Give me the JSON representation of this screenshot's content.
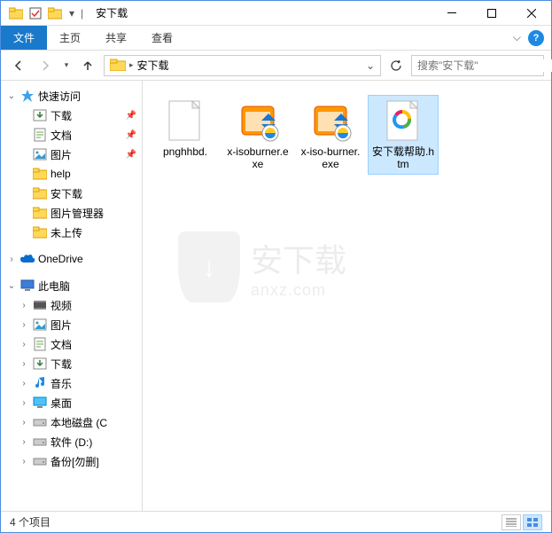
{
  "window": {
    "title": "安下载"
  },
  "ribbon": {
    "file": "文件",
    "home": "主页",
    "share": "共享",
    "view": "查看"
  },
  "address": {
    "path": "安下载"
  },
  "search": {
    "placeholder": "搜索\"安下载\""
  },
  "sidebar": {
    "quick_access": "快速访问",
    "items": [
      {
        "label": "下载",
        "pinned": true,
        "icon": "download"
      },
      {
        "label": "文档",
        "pinned": true,
        "icon": "document"
      },
      {
        "label": "图片",
        "pinned": true,
        "icon": "pictures"
      },
      {
        "label": "help",
        "pinned": false,
        "icon": "folder"
      },
      {
        "label": "安下载",
        "pinned": false,
        "icon": "folder"
      },
      {
        "label": "图片管理器",
        "pinned": false,
        "icon": "folder"
      },
      {
        "label": "未上传",
        "pinned": false,
        "icon": "folder"
      }
    ],
    "onedrive": "OneDrive",
    "this_pc": "此电脑",
    "pc_items": [
      {
        "label": "视频",
        "icon": "video"
      },
      {
        "label": "图片",
        "icon": "pictures"
      },
      {
        "label": "文档",
        "icon": "document"
      },
      {
        "label": "下载",
        "icon": "download"
      },
      {
        "label": "音乐",
        "icon": "music"
      },
      {
        "label": "桌面",
        "icon": "desktop"
      },
      {
        "label": "本地磁盘 (C",
        "icon": "drive"
      },
      {
        "label": "软件 (D:)",
        "icon": "drive"
      },
      {
        "label": "备份[勿删]",
        "icon": "drive"
      }
    ]
  },
  "files": [
    {
      "name": "pnghhbd.",
      "type": "blank"
    },
    {
      "name": "x-isoburner.exe",
      "type": "exe"
    },
    {
      "name": "x-iso-burner.exe",
      "type": "exe"
    },
    {
      "name": "安下载帮助.htm",
      "type": "htm"
    }
  ],
  "status": {
    "count": "4 个项目"
  },
  "watermark": {
    "cn": "安下载",
    "en": "anxz.com"
  }
}
